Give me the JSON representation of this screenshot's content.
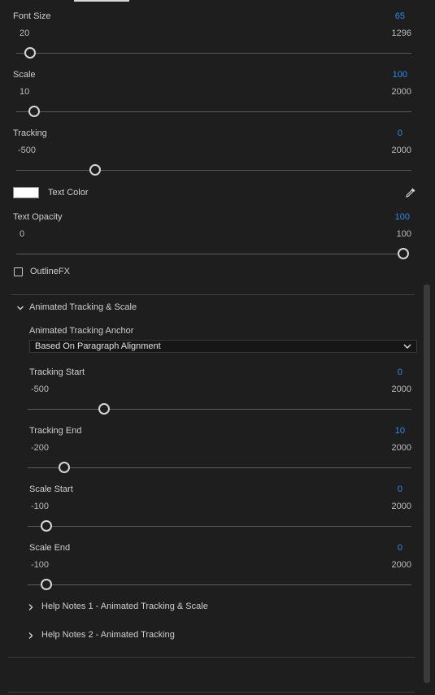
{
  "font_size": {
    "label": "Font Size",
    "value": "65",
    "min": "20",
    "max": "1296",
    "level": 0.035
  },
  "scale": {
    "label": "Scale",
    "value": "100",
    "min": "10",
    "max": "2000",
    "level": 0.045
  },
  "tracking": {
    "label": "Tracking",
    "value": "0",
    "min": "-500",
    "max": "2000",
    "level": 0.2
  },
  "text_color": {
    "label": "Text Color",
    "swatch": "#ffffff"
  },
  "text_opacity": {
    "label": "Text  Opacity",
    "value": "100",
    "min": "0",
    "max": "100",
    "level": 1.0
  },
  "outlinefx": {
    "label": "OutlineFX",
    "checked": false
  },
  "section": {
    "title": "Animated Tracking & Scale",
    "anchor_label": "Animated Tracking Anchor",
    "anchor_value": "Based On Paragraph Alignment",
    "tracking_start": {
      "label": "Tracking Start",
      "value": "0",
      "min": "-500",
      "max": "2000",
      "level": 0.2
    },
    "tracking_end": {
      "label": "Tracking End",
      "value": "10",
      "min": "-200",
      "max": "2000",
      "level": 0.095
    },
    "scale_start": {
      "label": "Scale Start",
      "value": "0",
      "min": "-100",
      "max": "2000",
      "level": 0.048
    },
    "scale_end": {
      "label": "Scale End",
      "value": "0",
      "min": "-100",
      "max": "2000",
      "level": 0.048
    },
    "help_1": "Help Notes 1 - Animated Tracking & Scale",
    "help_2": "Help Notes 2 - Animated Tracking"
  },
  "colors": {
    "accent": "#2d8ceb",
    "background": "#1e1e1e"
  }
}
